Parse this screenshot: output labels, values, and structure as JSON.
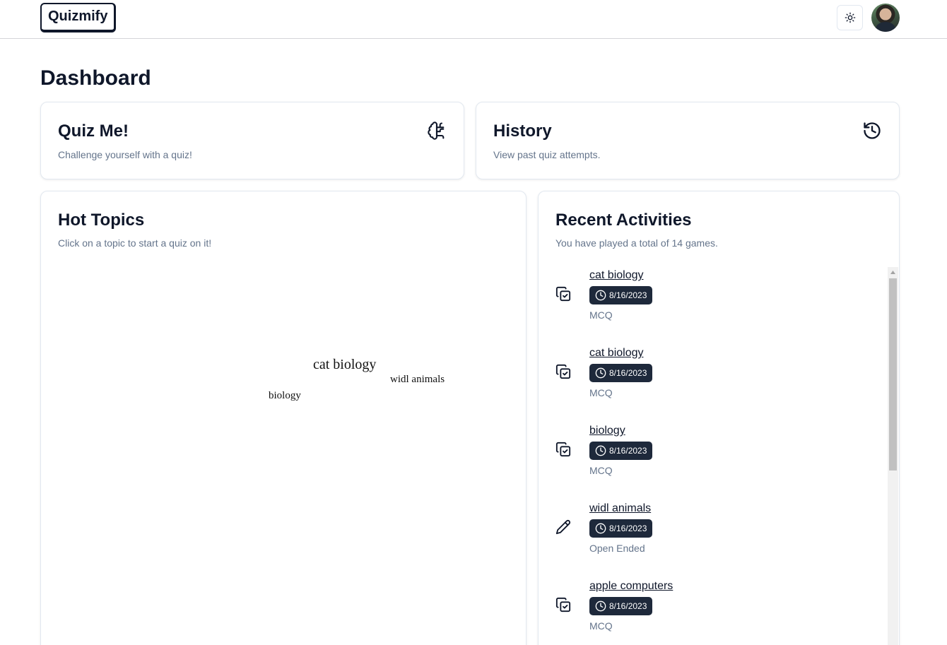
{
  "navbar": {
    "logo": "Quizmify",
    "theme_toggle_icon": "sun-icon",
    "avatar_icon": "user-avatar"
  },
  "page": {
    "title": "Dashboard"
  },
  "quiz_card": {
    "title": "Quiz Me!",
    "subtitle": "Challenge yourself with a quiz!",
    "icon": "brain-circuit-icon"
  },
  "history_card": {
    "title": "History",
    "subtitle": "View past quiz attempts.",
    "icon": "history-icon"
  },
  "hot_topics": {
    "title": "Hot Topics",
    "subtitle": "Click on a topic to start a quiz on it!",
    "words": [
      {
        "text": "cat biology"
      },
      {
        "text": "widl animals"
      },
      {
        "text": "biology"
      }
    ]
  },
  "recent": {
    "title": "Recent Activities",
    "subtitle": "You have played a total of 14 games.",
    "items": [
      {
        "topic": "cat biology",
        "date": "8/16/2023",
        "type": "MCQ",
        "icon": "copy-check-icon"
      },
      {
        "topic": "cat biology",
        "date": "8/16/2023",
        "type": "MCQ",
        "icon": "copy-check-icon"
      },
      {
        "topic": "biology",
        "date": "8/16/2023",
        "type": "MCQ",
        "icon": "copy-check-icon"
      },
      {
        "topic": "widl animals",
        "date": "8/16/2023",
        "type": "Open Ended",
        "icon": "pencil-icon"
      },
      {
        "topic": "apple computers",
        "date": "8/16/2023",
        "type": "MCQ",
        "icon": "copy-check-icon"
      }
    ]
  },
  "colors": {
    "text": "#0f172a",
    "muted": "#64748b",
    "badge_bg": "#1e293b",
    "border": "#e2e8f0"
  }
}
